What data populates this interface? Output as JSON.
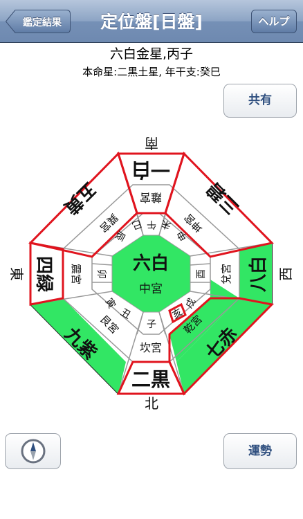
{
  "nav": {
    "back_label": "鑑定結果",
    "title": "定位盤[日盤]",
    "help_label": "ヘルプ"
  },
  "header": {
    "main": "六白金星,丙子",
    "sub": "本命星:二黒土星, 年干支:癸巳"
  },
  "buttons": {
    "share": "共有",
    "fortune": "運勢",
    "compass_icon": "compass-icon"
  },
  "colors": {
    "highlight_green": "#32e664",
    "red_line": "#e0141e",
    "nav_blue": "#7590b6",
    "button_text": "#2f4f7f"
  },
  "board": {
    "directions": {
      "south": "南",
      "north": "北",
      "east": "東",
      "west": "西"
    },
    "center": {
      "star": "六白",
      "palace": "中宮"
    },
    "outer": {
      "south": {
        "star": "一白",
        "palace": "離宮"
      },
      "southwest": {
        "star": "三碧",
        "palace": "坤宮"
      },
      "west": {
        "star": "八白",
        "palace": "兌宮"
      },
      "northwest": {
        "star": "七赤",
        "palace": "乾宮"
      },
      "north": {
        "star": "二黒",
        "palace": "坎宮"
      },
      "northeast": {
        "star": "九紫",
        "palace": "艮宮"
      },
      "east": {
        "star": "四緑",
        "palace": "震宮"
      },
      "southeast": {
        "star": "五黄",
        "palace": "巽宮"
      }
    },
    "branches": {
      "s_left": "巳",
      "s_mid": "午",
      "s_right": "未",
      "w_top": "申",
      "w_mid": "酉",
      "w_bot": "戌",
      "n_right": "亥",
      "n_mid": "子",
      "n_left": "丑",
      "e_bot": "寅",
      "e_mid": "卯",
      "e_top": "辰"
    }
  }
}
